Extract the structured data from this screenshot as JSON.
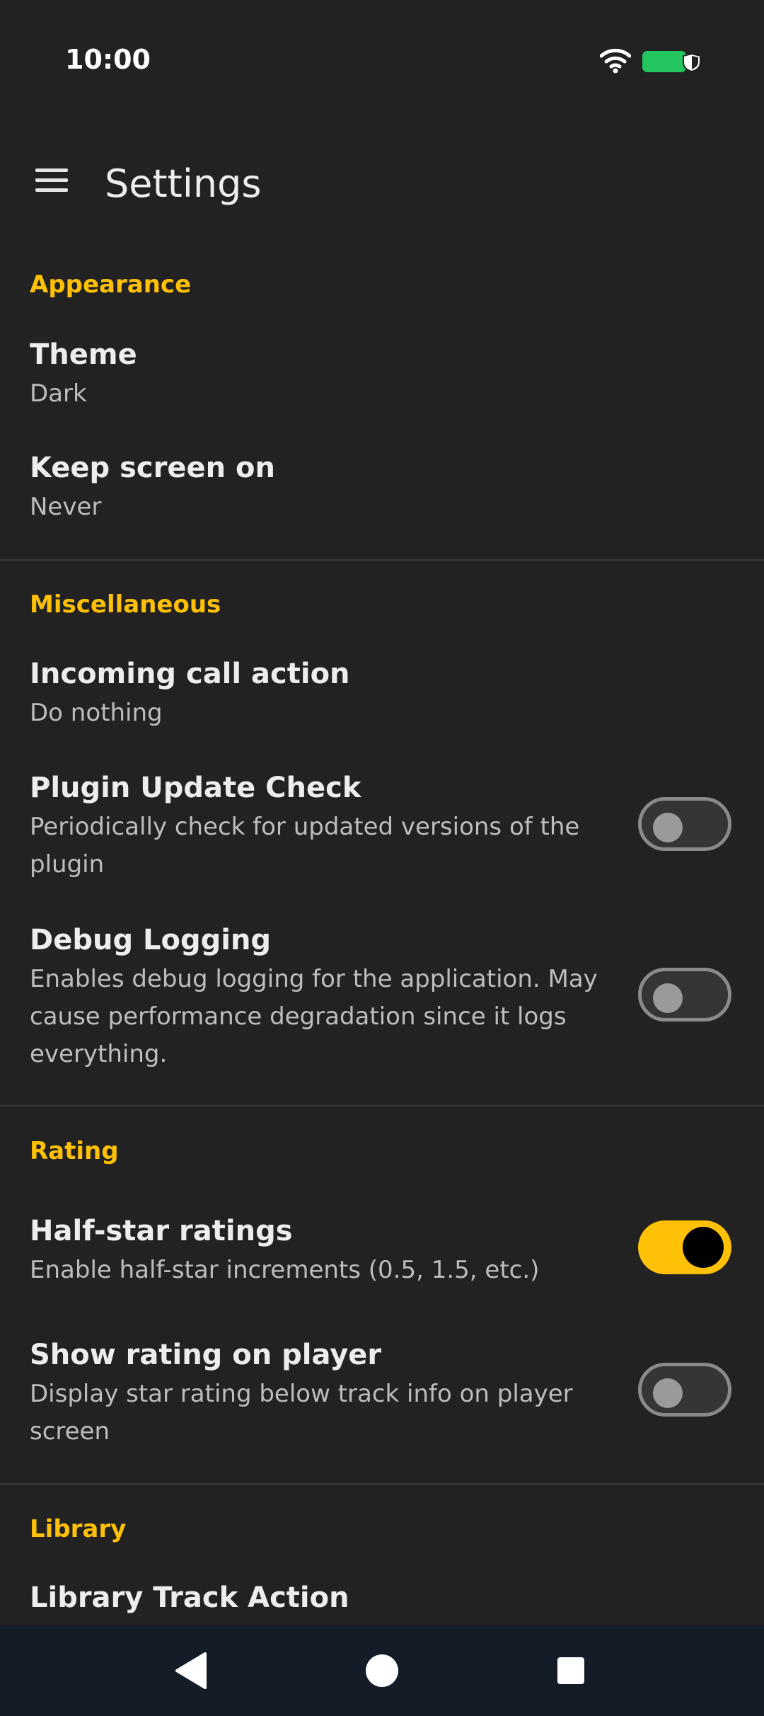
{
  "status_bar": {
    "time": "10:00",
    "icons": [
      "wifi-icon",
      "battery-icon",
      "shield-icon"
    ],
    "battery_color": "#22C55E"
  },
  "app_bar": {
    "title": "Settings",
    "menu_icon": "hamburger-menu-icon"
  },
  "colors": {
    "background": "#222222",
    "accent": "#FFC107",
    "nav_bar": "#131C27"
  },
  "sections": {
    "appearance": {
      "header": "Appearance",
      "theme": {
        "title": "Theme",
        "summary": "Dark"
      },
      "keep_screen_on": {
        "title": "Keep screen on",
        "summary": "Never"
      }
    },
    "miscellaneous": {
      "header": "Miscellaneous",
      "incoming_call": {
        "title": "Incoming call action",
        "summary": "Do nothing"
      },
      "plugin_update": {
        "title": "Plugin Update Check",
        "summary": "Periodically check for updated versions of the plugin",
        "enabled": false
      },
      "debug_logging": {
        "title": "Debug Logging",
        "summary": "Enables debug logging for the application. May cause performance degradation since it logs everything.",
        "enabled": false
      }
    },
    "rating": {
      "header": "Rating",
      "half_star": {
        "title": "Half-star ratings",
        "summary": "Enable half-star increments (0.5, 1.5, etc.)",
        "enabled": true
      },
      "show_rating": {
        "title": "Show rating on player",
        "summary": "Display star rating below track info on player screen",
        "enabled": false
      }
    },
    "library": {
      "header": "Library",
      "track_action": {
        "title": "Library Track Action"
      }
    }
  },
  "nav_bar": {
    "buttons": [
      "back-icon",
      "home-icon",
      "recents-icon"
    ]
  }
}
